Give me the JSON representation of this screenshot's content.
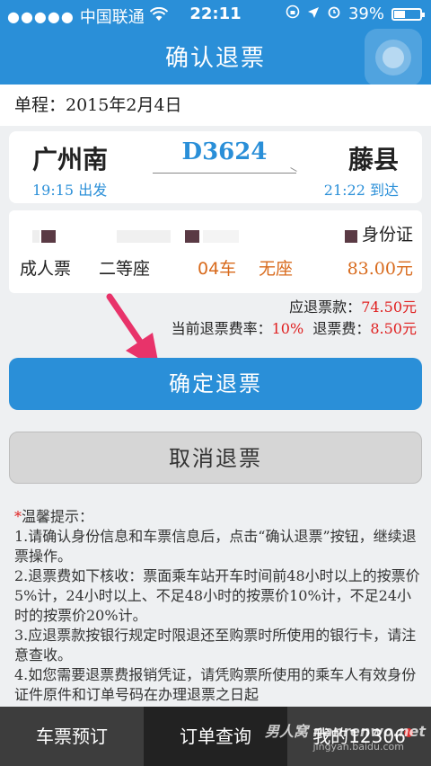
{
  "status_bar": {
    "carrier": "中国联通",
    "time": "22:11",
    "battery": "39%"
  },
  "header": {
    "title": "确认退票"
  },
  "trip": {
    "date_label": "单程：2015年2月4日"
  },
  "train": {
    "from_station": "广州南",
    "to_station": "藤县",
    "train_number": "D3624",
    "depart": "19:15 出发",
    "arrive": "21:22 到达"
  },
  "passenger": {
    "id_type": "身份证",
    "ticket_type": "成人票",
    "seat_class": "二等座",
    "car": "04车",
    "seat": "无座",
    "price": "83.00元"
  },
  "fees": {
    "refund_label": "应退票款：",
    "refund_amount": "74.50元",
    "rate_label": "当前退票费率：",
    "rate_value": "10%",
    "fee_label": "退票费：",
    "fee_amount": "8.50元"
  },
  "buttons": {
    "confirm": "确定退票",
    "cancel": "取消退票"
  },
  "tips": {
    "title": "温馨提示：",
    "items": [
      "1.请确认身份信息和车票信息后，点击“确认退票”按钮，继续退票操作。",
      "2.退票费如下核收：票面乘车站开车时间前48小时以上的按票价5%计，24小时以上、不足48小时的按票价10%计，不足24小时的按票价20%计。",
      "3.应退票款按银行规定时限退还至购票时所使用的银行卡，请注意查收。",
      "4.如您需要退票费报销凭证，请凭购票所使用的乘车人有效身份证件原件和订单号码在办理退票之日起"
    ]
  },
  "tabbar": {
    "tabs": [
      "车票预订",
      "订单查询",
      "我的12306"
    ]
  },
  "watermark": {
    "text": "男人窝 nanrenwo.net",
    "sub": "jingyan.baidu.com"
  },
  "colors": {
    "primary": "#2a8fd8",
    "accent_orange": "#d86a1c",
    "accent_red": "#e02020",
    "tabbar": "#3d3d3d"
  }
}
